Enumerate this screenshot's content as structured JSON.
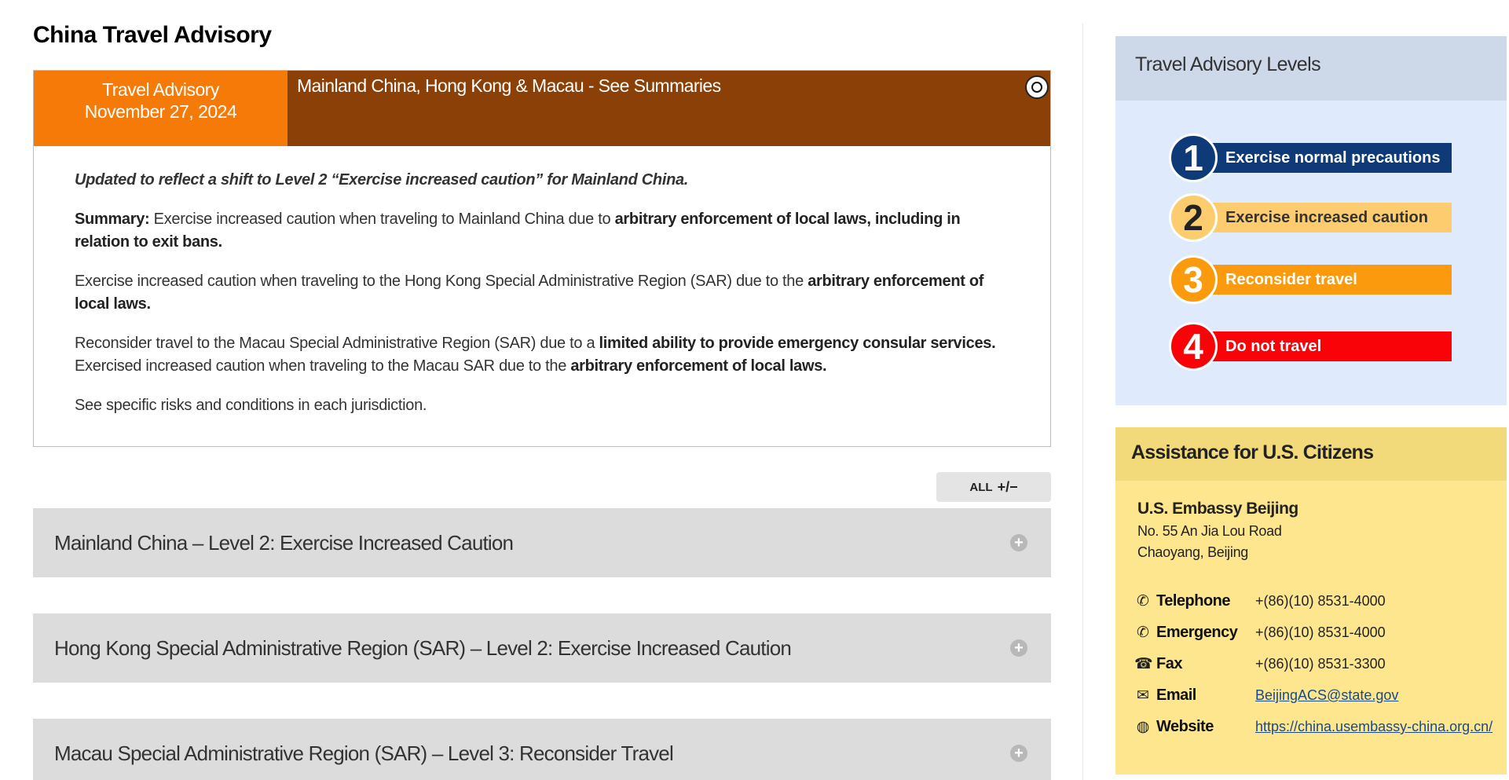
{
  "page": {
    "title": "China Travel Advisory"
  },
  "advisory": {
    "label": "Travel Advisory",
    "date": "November 27, 2024",
    "region_title": "Mainland China, Hong Kong & Macau - See Summaries",
    "toggle_glyph": "O",
    "update_note": "Updated to reflect a shift to Level 2 “Exercise increased caution” for Mainland China.",
    "summary_label": "Summary:",
    "summary_text": " Exercise increased caution when traveling to Mainland China due to ",
    "summary_bold": "arbitrary enforcement of local laws, including in relation to exit bans.",
    "hk_text": "Exercise increased caution when traveling to the Hong Kong Special Administrative Region (SAR) due to the ",
    "hk_bold": "arbitrary enforcement of local laws.",
    "macau_text1": "Reconsider travel to the Macau Special Administrative Region (SAR) due to a ",
    "macau_bold1": "limited ability to provide emergency consular services.",
    "macau_text2": "Exercised increased caution when traveling to the Macau SAR due to the ",
    "macau_bold2": "arbitrary enforcement of local laws.",
    "closing": "See specific risks and conditions in each jurisdiction."
  },
  "all_toggle": {
    "label": "ALL",
    "icon": "+/−"
  },
  "accordions": [
    {
      "label": "Mainland China – Level 2: Exercise Increased Caution",
      "icon": "+"
    },
    {
      "label": "Hong Kong Special Administrative Region (SAR) – Level 2: Exercise Increased Caution",
      "icon": "+"
    },
    {
      "label": "Macau Special Administrative Region (SAR) – Level 3: Reconsider Travel",
      "icon": "+"
    }
  ],
  "levels": {
    "title": "Travel Advisory Levels",
    "items": [
      {
        "number": "1",
        "label": "Exercise normal precautions",
        "color": "#0e3a78",
        "text_color": "#ffffff",
        "circle_text": "#ffffff"
      },
      {
        "number": "2",
        "label": "Exercise increased caution",
        "color": "#fdcc6e",
        "text_color": "#333333",
        "circle_text": "#222222"
      },
      {
        "number": "3",
        "label": "Reconsider travel",
        "color": "#fb9a0c",
        "text_color": "#ffffff",
        "circle_text": "#ffffff"
      },
      {
        "number": "4",
        "label": "Do not travel",
        "color": "#f90208",
        "text_color": "#ffffff",
        "circle_text": "#ffffff"
      }
    ]
  },
  "assistance": {
    "title": "Assistance for U.S. Citizens",
    "embassy_name": "U.S. Embassy Beijing",
    "address_line1": "No. 55 An Jia Lou Road",
    "address_line2": "Chaoyang, Beijing",
    "contacts": [
      {
        "icon": "phone-icon",
        "glyph": "✆",
        "label": "Telephone",
        "value": "+(86)(10) 8531-4000",
        "link": false
      },
      {
        "icon": "phone-icon",
        "glyph": "✆",
        "label": "Emergency",
        "value": "+(86)(10) 8531-4000",
        "link": false
      },
      {
        "icon": "fax-icon",
        "glyph": "☎",
        "label": "Fax",
        "value": "+(86)(10) 8531-3300",
        "link": false
      },
      {
        "icon": "envelope-icon",
        "glyph": "✉",
        "label": "Email",
        "value": "BeijingACS@state.gov",
        "link": true
      },
      {
        "icon": "globe-icon",
        "glyph": "◍",
        "label": "Website",
        "value": "https://china.usembassy-china.org.cn/",
        "link": true
      }
    ]
  }
}
